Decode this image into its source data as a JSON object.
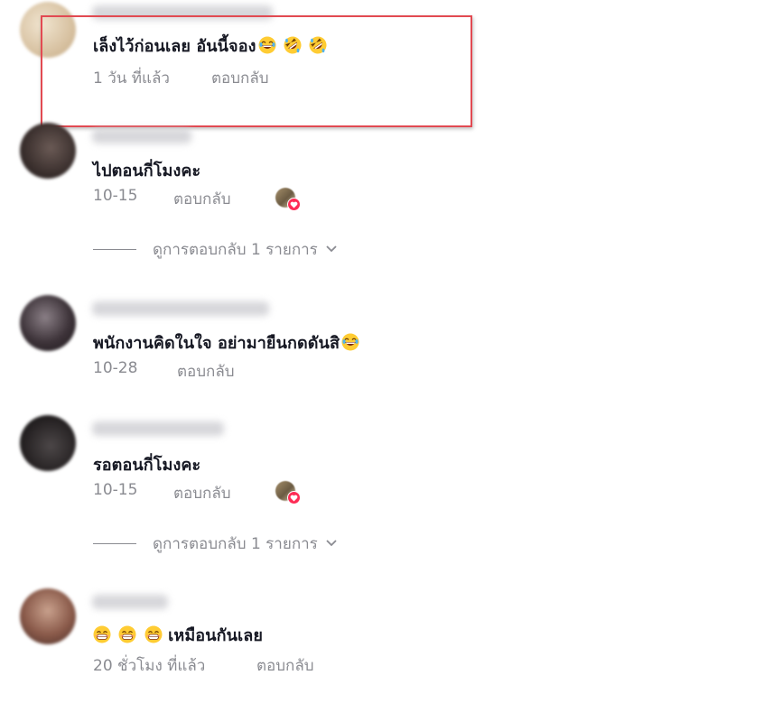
{
  "highlight_color": "#e24a52",
  "comments": [
    {
      "text": "เล็งไว้ก่อนเลย อันนี้จอง",
      "emojis": [
        "laughing-face",
        "rolling-laughing-face",
        "rolling-laughing-face"
      ],
      "time": "1 วัน ที่แล้ว",
      "reply_label": "ตอบกลับ",
      "highlighted": true
    },
    {
      "text": "ไปตอนกี่โมงคะ",
      "time": "10-15",
      "reply_label": "ตอบกลับ",
      "liked_by_creator": true,
      "view_replies_label": "ดูการตอบกลับ 1 รายการ"
    },
    {
      "text": "พนักงานคิดในใจ อย่ามายืนกดดันสิ",
      "emojis": [
        "laughing-face"
      ],
      "time": "10-28",
      "reply_label": "ตอบกลับ"
    },
    {
      "text": "รอตอนกี่โมงคะ",
      "time": "10-15",
      "reply_label": "ตอบกลับ",
      "liked_by_creator": true,
      "view_replies_label": "ดูการตอบกลับ 1 รายการ"
    },
    {
      "text": "เหมือนกันเลย",
      "leading_emojis": [
        "grinning-face",
        "grinning-face",
        "grinning-face"
      ],
      "time": "20 ชั่วโมง ที่แล้ว",
      "reply_label": "ตอบกลับ"
    }
  ]
}
